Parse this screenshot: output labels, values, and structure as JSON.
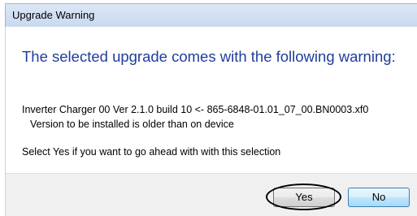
{
  "dialog": {
    "title": "Upgrade Warning",
    "heading": "The selected upgrade comes with the following warning:",
    "detail_line1": "Inverter Charger 00 Ver 2.1.0 build 10 <- 865-6848-01.01_07_00.BN0003.xf0",
    "detail_line2": "Version to be installed is older than on device",
    "prompt": "Select Yes if you want to go ahead with with this selection"
  },
  "buttons": {
    "yes_label": "Yes",
    "no_label": "No"
  },
  "colors": {
    "heading": "#1f3d9c",
    "titlebar": "#c9d9ef",
    "footer": "#f0f0f0"
  }
}
